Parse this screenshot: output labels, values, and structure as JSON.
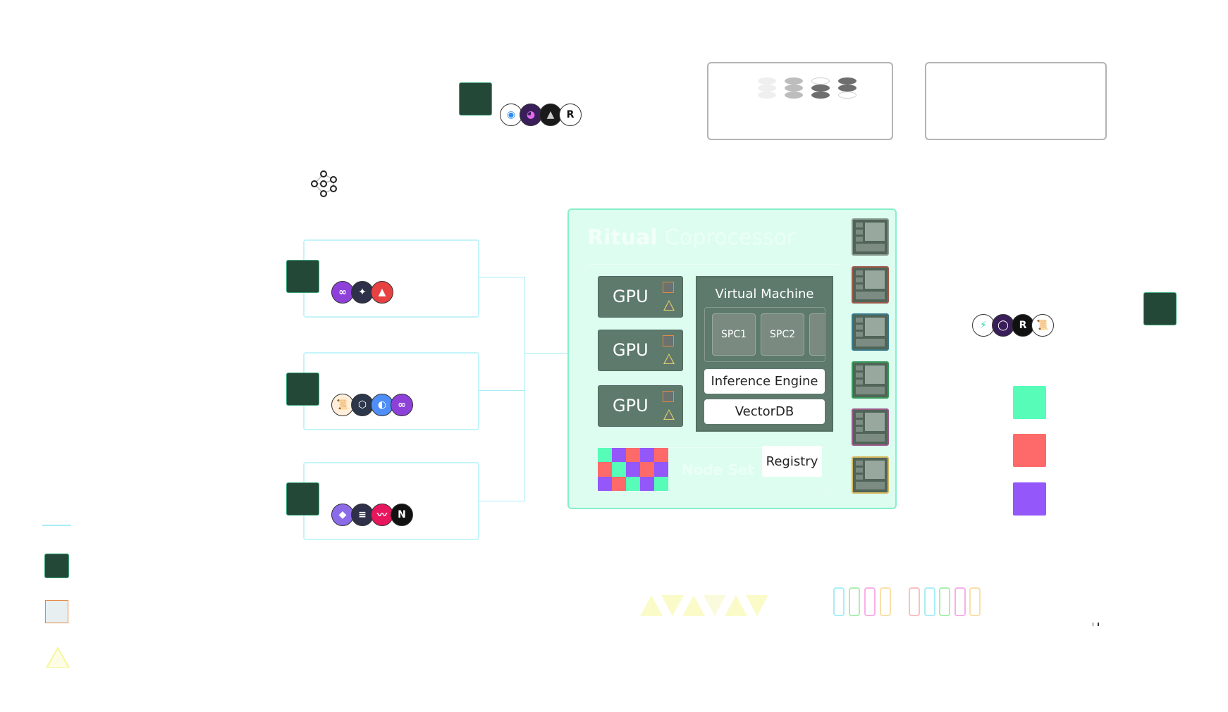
{
  "diagram": {
    "title": "Ritual Coprocessor",
    "title_bold": "Ritual",
    "title_thin": "Coprocessor",
    "gpus": [
      "GPU",
      "GPU",
      "GPU"
    ],
    "virtual_machine": {
      "title": "Virtual Machine",
      "spcs": [
        "SPC1",
        "SPC2"
      ],
      "components": [
        "Inference Engine",
        "VectorDB"
      ]
    },
    "node_set_label": "Node Set",
    "registry_label": "Registry",
    "servers": [
      {
        "border_color": "#8a9a90"
      },
      {
        "border_color": "#a05a4a"
      },
      {
        "border_color": "#3a7a8a"
      },
      {
        "border_color": "#3a9a5a"
      },
      {
        "border_color": "#9a5a8a"
      },
      {
        "border_color": "#d4b860"
      }
    ],
    "checker_colors": [
      "#56fcb8",
      "#9457fa",
      "#fe6a69",
      "#9457fa",
      "#fe6a69",
      "#fe6a69",
      "#56fcb8",
      "#9457fa",
      "#fe6a69",
      "#9457fa",
      "#9457fa",
      "#fe6a69",
      "#56fcb8",
      "#9457fa",
      "#56fcb8"
    ],
    "chain_groups": [
      {
        "logos": [
          {
            "name": "polygon",
            "color": "#8e41d8",
            "glyph": "∞"
          },
          {
            "name": "cosmos",
            "color": "#2e3149",
            "glyph": "✦"
          },
          {
            "name": "avalanche",
            "color": "#e84142",
            "glyph": "▲"
          }
        ]
      },
      {
        "logos": [
          {
            "name": "scroll",
            "color": "#ffeeda",
            "glyph": "📜"
          },
          {
            "name": "arbitrum",
            "color": "#2d374b",
            "glyph": "⬡"
          },
          {
            "name": "base",
            "color": "#4f8ef7",
            "glyph": "◐"
          },
          {
            "name": "polygon",
            "color": "#8e41d8",
            "glyph": "∞"
          }
        ]
      },
      {
        "logos": [
          {
            "name": "ethereum",
            "color": "#8c6be8",
            "glyph": "◆"
          },
          {
            "name": "solana",
            "color": "#2e3149",
            "glyph": "≡"
          },
          {
            "name": "mantra",
            "color": "#e8175d",
            "glyph": "〰"
          },
          {
            "name": "near",
            "color": "#111111",
            "glyph": "N"
          }
        ]
      }
    ],
    "top_logos": [
      {
        "name": "blue-mascot",
        "color": "#ffffff",
        "glyph": "◉",
        "fg": "#2d8cf0"
      },
      {
        "name": "purple-blob",
        "color": "#3a1e5a",
        "glyph": "◕",
        "fg": "#e36af0"
      },
      {
        "name": "shark",
        "color": "#1a1a1a",
        "glyph": "▲",
        "fg": "#cccccc"
      },
      {
        "name": "r-logo",
        "color": "#ffffff",
        "glyph": "R",
        "fg": "#111111"
      }
    ],
    "right_logos": [
      {
        "name": "bolt",
        "color": "#ffffff",
        "glyph": "⚡",
        "fg": "#2dd4a8"
      },
      {
        "name": "ring",
        "color": "#3a1e5a",
        "glyph": "◯",
        "fg": "#ffffff"
      },
      {
        "name": "rc-logo",
        "color": "#111111",
        "glyph": "R",
        "fg": "#ffffff"
      },
      {
        "name": "scroll",
        "color": "#ffffff",
        "glyph": "📜",
        "fg": "#c04a3a"
      }
    ],
    "status_colors": [
      "#56fcb8",
      "#fe6a69",
      "#9457fa"
    ],
    "triangle_colors": [
      "#f6f79a",
      "#f6f79a",
      "#f6f79a",
      "#f6f7c0",
      "#f6f79a",
      "#f6f79a"
    ],
    "pill_colors_a": [
      "#a9eef6",
      "#a9f0b0",
      "#f8b0e6",
      "#f8e0a8"
    ],
    "pill_colors_b": [
      "#fbc0c0",
      "#a9eef6",
      "#a9f0b0",
      "#f8b0e6",
      "#f8e0a8"
    ],
    "legend": {
      "line_color": "#a9eef6",
      "node_color": "#244838",
      "gpu_color": "#e68840",
      "tri_color": "#f6f79a"
    }
  }
}
